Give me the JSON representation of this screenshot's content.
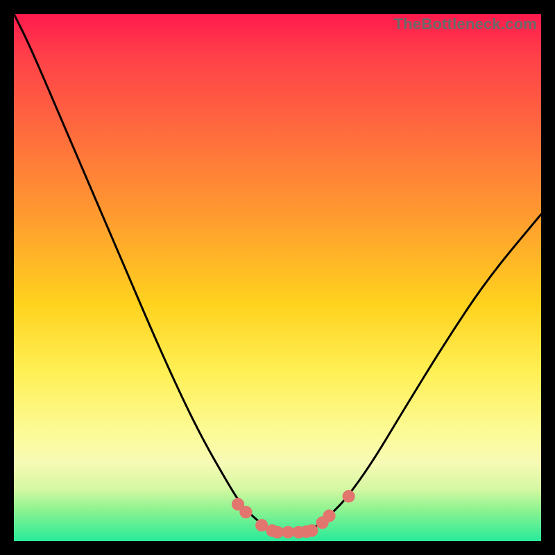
{
  "watermark": "TheBottleneck.com",
  "chart_data": {
    "type": "line",
    "title": "",
    "xlabel": "",
    "ylabel": "",
    "xlim": [
      0,
      1
    ],
    "ylim": [
      0,
      1
    ],
    "annotations": [],
    "series": [
      {
        "name": "curve",
        "x": [
          0.0,
          0.03,
          0.09,
          0.15,
          0.21,
          0.27,
          0.32,
          0.36,
          0.4,
          0.43,
          0.46,
          0.49,
          0.52,
          0.55,
          0.58,
          0.6,
          0.63,
          0.68,
          0.74,
          0.82,
          0.9,
          1.0
        ],
        "y": [
          1.0,
          0.94,
          0.8,
          0.66,
          0.52,
          0.38,
          0.27,
          0.19,
          0.12,
          0.07,
          0.04,
          0.02,
          0.02,
          0.02,
          0.03,
          0.05,
          0.08,
          0.15,
          0.25,
          0.38,
          0.5,
          0.62
        ]
      }
    ],
    "markers": {
      "color": "#e2766e",
      "radius_norm": 0.012,
      "points_x": [
        0.425,
        0.44,
        0.47,
        0.49,
        0.5,
        0.52,
        0.54,
        0.555,
        0.565,
        0.585,
        0.598,
        0.635
      ],
      "points_y": [
        0.07,
        0.055,
        0.03,
        0.02,
        0.017,
        0.017,
        0.017,
        0.018,
        0.02,
        0.035,
        0.048,
        0.085
      ]
    }
  }
}
